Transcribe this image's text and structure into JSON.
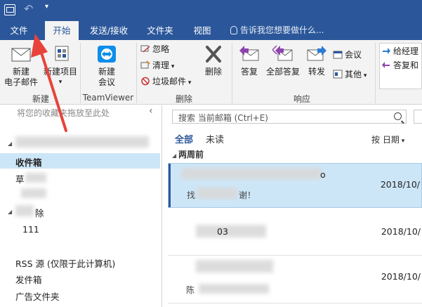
{
  "tabs": [
    "文件",
    "开始",
    "发送/接收",
    "文件夹",
    "视图"
  ],
  "tell_me": "告诉我您想要做什么...",
  "ribbon": {
    "new_email": [
      "新建",
      "电子邮件"
    ],
    "new_items": "新建项目",
    "group_new": "新建",
    "new_meeting": [
      "新建",
      "会议"
    ],
    "group_teamviewer": "TeamViewer",
    "ignore": "忽略",
    "clean_up": "清理",
    "junk": "垃圾邮件",
    "delete": "删除",
    "group_delete": "删除",
    "reply": "答复",
    "reply_all": "全部答复",
    "forward": "转发",
    "meeting": "会议",
    "more": "其他",
    "group_respond": "响应",
    "quick_step_1": "给经理",
    "quick_step_2": "答复和"
  },
  "nav": {
    "fav_hint": "将您的收藏夹拖放至此处",
    "inbox": "收件箱",
    "drafts": "草",
    "deleted_frag": "除",
    "folder_111": "111",
    "rss": "RSS 源 (仅限于此计算机)",
    "outbox": "发件箱",
    "ads": "广告文件夹"
  },
  "list": {
    "search_placeholder": "搜索 当前邮箱 (Ctrl+E)",
    "filter_all": "全部",
    "filter_unread": "未读",
    "sort": "按 日期",
    "group_header": "两周前",
    "messages": [
      {
        "from_tail": "o",
        "preview_head": "找",
        "preview_tail": "谢！",
        "date": "2018/10/"
      },
      {
        "from_tail": "03",
        "preview_head": "",
        "preview_tail": "",
        "date": "2018/10/"
      },
      {
        "from_tail": "",
        "preview_head": "陈",
        "preview_tail": "",
        "date": "2018/10/"
      }
    ]
  },
  "colors": {
    "accent": "#2b579a",
    "selection": "#cde6f7",
    "arrow": "#e8433a"
  }
}
